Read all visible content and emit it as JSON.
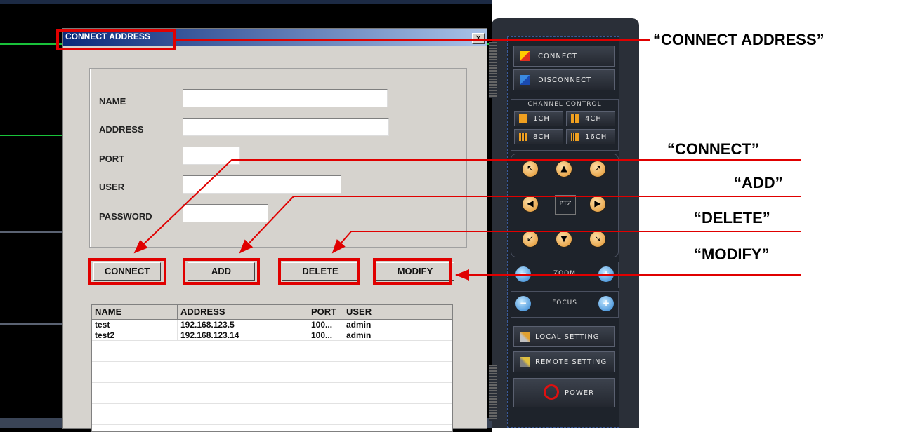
{
  "dialog": {
    "title": "CONNECT ADDRESS",
    "close_glyph": "×",
    "fields": {
      "name_label": "NAME",
      "address_label": "ADDRESS",
      "port_label": "PORT",
      "user_label": "USER",
      "password_label": "PASSWORD",
      "name_value": "",
      "address_value": "",
      "port_value": "",
      "user_value": "",
      "password_value": ""
    },
    "buttons": {
      "connect": "CONNECT",
      "add": "ADD",
      "delete": "DELETE",
      "modify": "MODIFY"
    },
    "list": {
      "columns": [
        "NAME",
        "ADDRESS",
        "PORT",
        "USER"
      ],
      "rows": [
        [
          "test",
          "192.168.123.5",
          "100...",
          "admin"
        ],
        [
          "test2",
          "192.168.123.14",
          "100...",
          "admin"
        ]
      ]
    }
  },
  "panel": {
    "connect": "CONNECT",
    "disconnect": "DISCONNECT",
    "channel_control": "CHANNEL CONTROL",
    "ch1": "1CH",
    "ch4": "4CH",
    "ch8": "8CH",
    "ch16": "16CH",
    "ptz": "PTZ",
    "zoom": "ZOOM",
    "focus": "FOCUS",
    "local_setting": "LOCAL SETTING",
    "remote_setting": "REMOTE SETTING",
    "power": "POWER"
  },
  "annotations": {
    "connect_address": "“CONNECT ADDRESS”",
    "connect": "“CONNECT”",
    "add": "“ADD”",
    "delete": "“DELETE”",
    "modify": "“MODIFY”"
  },
  "colors": {
    "highlight": "#e00000",
    "titlebar_start": "#0a2a7a",
    "dialog_bg": "#d6d3ce",
    "ptz_button": "#e09028"
  }
}
